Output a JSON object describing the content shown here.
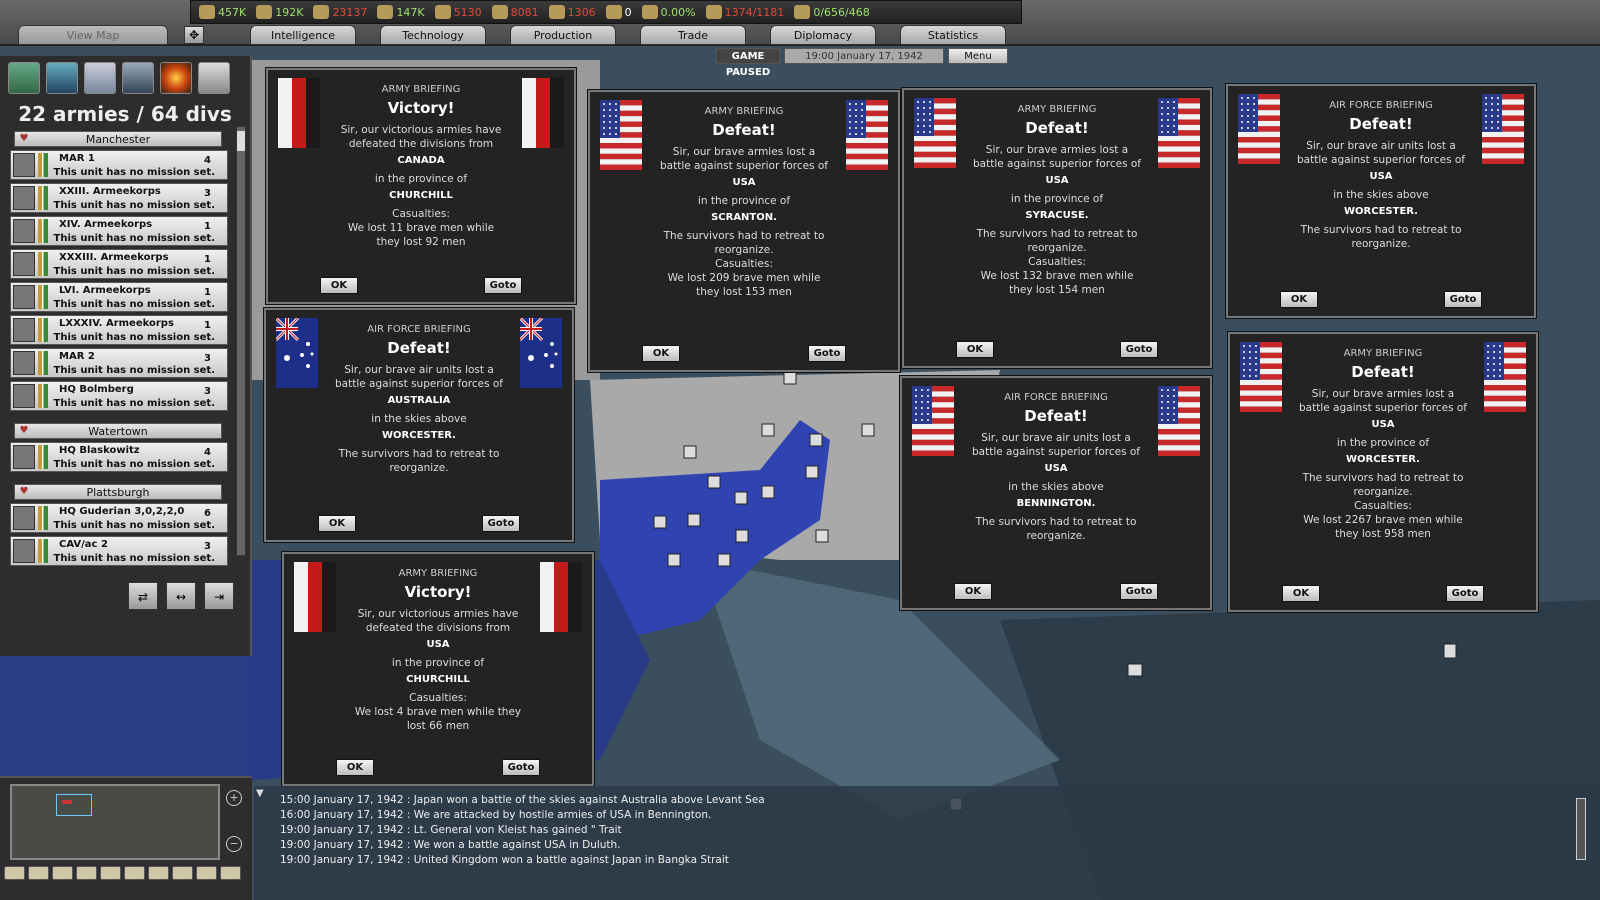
{
  "topbar": {
    "view_map_tab": "View Map",
    "tabs": [
      "Intelligence",
      "Technology",
      "Production",
      "Trade",
      "Diplomacy",
      "Statistics"
    ],
    "resources": [
      {
        "icon": "energy-icon",
        "value": "457K",
        "color": "#9fe06a"
      },
      {
        "icon": "metal-icon",
        "value": "192K",
        "color": "#9fe06a"
      },
      {
        "icon": "rare-materials-icon",
        "value": "23137",
        "color": "#e04a3a"
      },
      {
        "icon": "oil-icon",
        "value": "147K",
        "color": "#9fe06a"
      },
      {
        "icon": "supplies-icon",
        "value": "5130",
        "color": "#e04a3a"
      },
      {
        "icon": "money-icon",
        "value": "8081",
        "color": "#e04a3a"
      },
      {
        "icon": "manpower-icon",
        "value": "1306",
        "color": "#e04a3a"
      },
      {
        "icon": "nuclear-icon",
        "value": "0",
        "color": "#ffffff"
      },
      {
        "icon": "dissent-icon",
        "value": "0.00%",
        "color": "#9fe06a"
      },
      {
        "icon": "transport-icon",
        "value": "1374/1181",
        "color": "#e04a3a"
      },
      {
        "icon": "convoy-icon",
        "value": "0/656/468",
        "color": "#9fe06a"
      }
    ],
    "game_status": "GAME PAUSED",
    "datetime": "19:00 January 17, 1942",
    "menu_label": "Menu"
  },
  "left_panel": {
    "armies_title": "22 armies / 64 divs",
    "groups": [
      {
        "name": "Manchester",
        "units": [
          {
            "name": "MAR 1",
            "divs": "4",
            "mission": "This unit has no mission set."
          },
          {
            "name": "XXIII. Armeekorps",
            "divs": "3",
            "mission": "This unit has no mission set."
          },
          {
            "name": "XIV. Armeekorps",
            "divs": "1",
            "mission": "This unit has no mission set."
          },
          {
            "name": "XXXIII. Armeekorps",
            "divs": "1",
            "mission": "This unit has no mission set."
          },
          {
            "name": "LVI. Armeekorps",
            "divs": "1",
            "mission": "This unit has no mission set."
          },
          {
            "name": "LXXXIV. Armeekorps",
            "divs": "1",
            "mission": "This unit has no mission set."
          },
          {
            "name": "MAR 2",
            "divs": "3",
            "mission": "This unit has no mission set."
          },
          {
            "name": "HQ Bolmberg",
            "divs": "3",
            "mission": "This unit has no mission set."
          }
        ]
      },
      {
        "name": "Watertown",
        "units": [
          {
            "name": "HQ Blaskowitz",
            "divs": "4",
            "mission": "This unit has no mission set."
          }
        ]
      },
      {
        "name": "Plattsburgh",
        "units": [
          {
            "name": "HQ Guderian 3,0,2,2,0",
            "divs": "6",
            "mission": "This unit has no mission set."
          },
          {
            "name": "CAV/ac 2",
            "divs": "3",
            "mission": "This unit has no mission set."
          }
        ]
      }
    ]
  },
  "briefings": [
    {
      "type": "ARMY BRIEFING",
      "title": "Victory!",
      "flag": "germany",
      "text": "Sir, our victorious armies have defeated the divisions from",
      "country": "CANADA",
      "place_label": "in the province of",
      "place": "CHURCHILL",
      "extra": "",
      "casualties_label": "Casualties:",
      "casualties": "We lost 11 brave men while they lost 92 men",
      "ok": "OK",
      "goto": "Goto"
    },
    {
      "type": "ARMY BRIEFING",
      "title": "Defeat!",
      "flag": "usa",
      "text": "Sir, our brave armies lost a battle against superior forces of",
      "country": "USA",
      "place_label": "in the province of",
      "place": "SCRANTON.",
      "extra": "The survivors had to retreat to reorganize.",
      "casualties_label": "Casualties:",
      "casualties": "We lost 209 brave men while they lost 153 men",
      "ok": "OK",
      "goto": "Goto"
    },
    {
      "type": "ARMY BRIEFING",
      "title": "Defeat!",
      "flag": "usa",
      "text": "Sir, our brave armies lost a battle against superior forces of",
      "country": "USA",
      "place_label": "in the province of",
      "place": "SYRACUSE.",
      "extra": "The survivors had to retreat to reorganize.",
      "casualties_label": "Casualties:",
      "casualties": "We lost 132 brave men while they lost 154 men",
      "ok": "OK",
      "goto": "Goto"
    },
    {
      "type": "AIR FORCE BRIEFING",
      "title": "Defeat!",
      "flag": "usa",
      "text": "Sir, our brave air units lost a battle against superior forces of",
      "country": "USA",
      "place_label": "in the skies above",
      "place": "WORCESTER.",
      "extra": "The survivors had to retreat to reorganize.",
      "casualties_label": "",
      "casualties": "",
      "ok": "OK",
      "goto": "Goto"
    },
    {
      "type": "AIR FORCE BRIEFING",
      "title": "Defeat!",
      "flag": "australia",
      "text": "Sir, our brave air units lost a battle against superior forces of",
      "country": "AUSTRALIA",
      "place_label": "in the skies above",
      "place": "WORCESTER.",
      "extra": "The survivors had to retreat to reorganize.",
      "casualties_label": "",
      "casualties": "",
      "ok": "OK",
      "goto": "Goto"
    },
    {
      "type": "AIR FORCE BRIEFING",
      "title": "Defeat!",
      "flag": "usa",
      "text": "Sir, our brave air units lost a battle against superior forces of",
      "country": "USA",
      "place_label": "in the skies above",
      "place": "BENNINGTON.",
      "extra": "The survivors had to retreat to reorganize.",
      "casualties_label": "",
      "casualties": "",
      "ok": "OK",
      "goto": "Goto"
    },
    {
      "type": "ARMY BRIEFING",
      "title": "Defeat!",
      "flag": "usa",
      "text": "Sir, our brave armies lost a battle against superior forces of",
      "country": "USA",
      "place_label": "in the province of",
      "place": "WORCESTER.",
      "extra": "The survivors had to retreat to reorganize.",
      "casualties_label": "Casualties:",
      "casualties": "We lost 2267 brave men while they lost 958 men",
      "ok": "OK",
      "goto": "Goto"
    },
    {
      "type": "ARMY BRIEFING",
      "title": "Victory!",
      "flag": "germany",
      "text": "Sir, our victorious armies have defeated the divisions from",
      "country": "USA",
      "place_label": "in the province of",
      "place": "CHURCHILL",
      "extra": "",
      "casualties_label": "Casualties:",
      "casualties": "We lost 4 brave men while they lost 66 men",
      "ok": "OK",
      "goto": "Goto"
    }
  ],
  "log": [
    "15:00 January 17, 1942 : Japan won a battle of the skies against Australia above Levant Sea",
    "16:00 January 17, 1942 : We are attacked by hostile armies of USA in Bennington.",
    "19:00 January 17, 1942 : Lt. General von Kleist has gained \" Trait",
    "19:00 January 17, 1942 : We won a battle against USA in Duluth.",
    "19:00 January 17, 1942 : United Kingdom won a battle against Japan in Bangka Strait"
  ],
  "colors": {
    "accent": "#3a4fa8",
    "enemy_land": "#b8b8b8",
    "sea": "#3a4d5c"
  }
}
